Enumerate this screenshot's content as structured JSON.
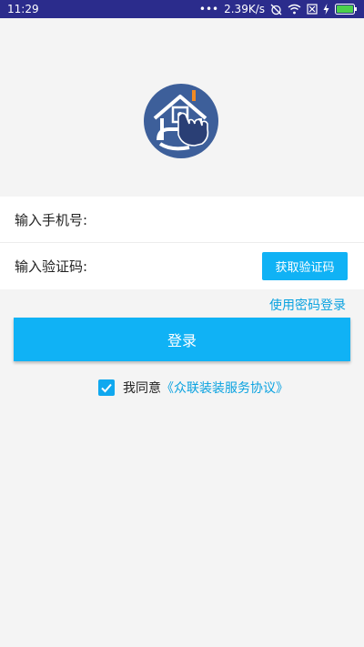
{
  "status_bar": {
    "time": "11:29",
    "dots": "•••",
    "speed": "2.39K/s",
    "icons": [
      "alarm-off-icon",
      "wifi-icon",
      "sim-off-icon",
      "charging-icon",
      "battery-icon"
    ],
    "background": "#2b2c8c"
  },
  "logo": {
    "icon": "house-touch-logo",
    "color": "#3d5f9a"
  },
  "form": {
    "phone_label": "输入手机号:",
    "phone_value": "",
    "phone_placeholder": "",
    "code_label": "输入验证码:",
    "code_value": "",
    "code_placeholder": "",
    "get_code_label": "获取验证码"
  },
  "password_login_link": "使用密码登录",
  "login_button_label": "登录",
  "agreement": {
    "checked": true,
    "text": "我同意",
    "link": "《众联装装服务协议》"
  },
  "colors": {
    "accent": "#10b2f5",
    "link": "#0aa2e0",
    "background": "#f4f4f4"
  }
}
